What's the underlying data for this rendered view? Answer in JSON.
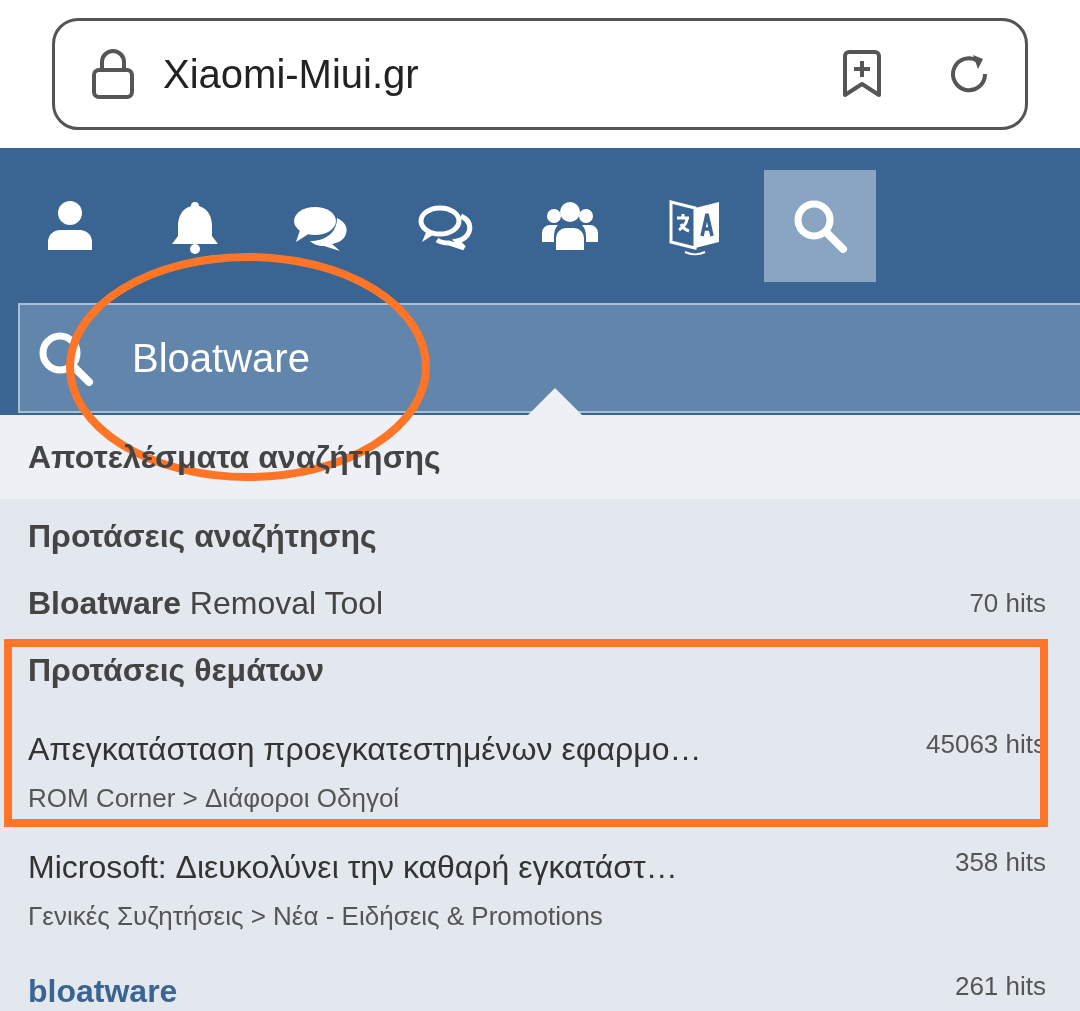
{
  "address_bar": {
    "url": "Xiaomi-Miui.gr"
  },
  "nav_icons": [
    {
      "kind": "user",
      "selected": false
    },
    {
      "kind": "bell",
      "selected": false
    },
    {
      "kind": "comments",
      "selected": false
    },
    {
      "kind": "comment",
      "selected": false
    },
    {
      "kind": "users",
      "selected": false
    },
    {
      "kind": "translate",
      "selected": false
    },
    {
      "kind": "search",
      "selected": true
    }
  ],
  "search": {
    "value": "Bloatware"
  },
  "results": {
    "title": "Αποτελέσματα αναζήτησης",
    "sections": [
      {
        "heading": "Προτάσεις αναζήτησης",
        "items": [
          {
            "kind": "suggestion",
            "title": "**Bloatware** Removal Tool",
            "hits": "70 hits"
          }
        ]
      },
      {
        "heading": "Προτάσεις θεμάτων",
        "items": [
          {
            "kind": "thread",
            "title": "Απεγκατάσταση προεγκατεστημένων εφαρμο…",
            "path": "ROM Corner > Διάφοροι Οδηγοί",
            "hits": "45063 hits"
          },
          {
            "kind": "thread",
            "title": "Microsoft: Διευκολύνει την καθαρή εγκατάστ…",
            "path": "Γενικές Συζητήσεις > Νέα - Ειδήσεις & Promotions",
            "hits": "358 hits"
          },
          {
            "kind": "tag",
            "title": "bloatware",
            "hits": "261 hits"
          }
        ]
      }
    ]
  },
  "annotations": [
    {
      "kind": "ellipse"
    },
    {
      "kind": "rectangle"
    }
  ]
}
